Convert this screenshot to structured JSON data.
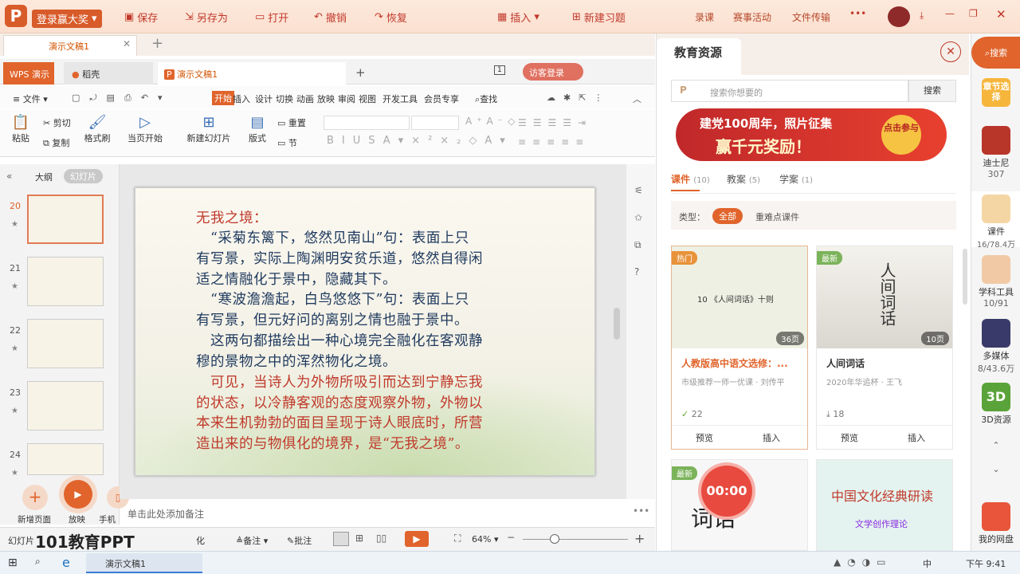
{
  "topbar": {
    "login": "登录赢大奖",
    "save": "保存",
    "save_as": "另存为",
    "open": "打开",
    "undo": "撤销",
    "redo": "恢复",
    "insert": "插入",
    "new_quiz": "新建习题",
    "record": "录课",
    "events": "赛事活动",
    "file_transfer": "文件传输"
  },
  "doc_tab": {
    "title": "演示文稿1"
  },
  "win_tabs": {
    "wps": "WPS 演示",
    "daoke": "稻壳",
    "doc": "演示文稿1",
    "guest_login": "访客登录"
  },
  "menu": {
    "file": "文件",
    "items": [
      "开始",
      "插入",
      "设计",
      "切换",
      "动画",
      "放映",
      "审阅",
      "视图",
      "开发工具",
      "会员专享"
    ],
    "search": "查找"
  },
  "ribbon": {
    "paste": "粘贴",
    "cut": "剪切",
    "copy": "复制",
    "format_painter": "格式刷",
    "from_current": "当页开始",
    "new_slide": "新建幻灯片",
    "layout": "版式",
    "reset": "重置",
    "section": "节"
  },
  "left_panel": {
    "outline": "大纲",
    "slides": "幻灯片",
    "numbers": [
      "20",
      "21",
      "22",
      "23",
      "24"
    ],
    "new_page": "新增页面",
    "play": "放映",
    "phone_remote": "手机遥控"
  },
  "slide": {
    "lines": [
      {
        "text": "无我之境：",
        "color": "#c0392b"
      },
      {
        "text": "“采菊东篱下，悠然见南山”句：表面上只",
        "color": "#1f3a5f"
      },
      {
        "text": "有写景，实际上陶渊明安贫乐道，悠然自得闲",
        "color": "#1f3a5f"
      },
      {
        "text": "适之情融化于景中，隐藏其下。",
        "color": "#1f3a5f"
      },
      {
        "text": "“寒波澹澹起，白鸟悠悠下”句：表面上只",
        "color": "#1f3a5f"
      },
      {
        "text": "有写景，但元好问的离别之情也融于景中。",
        "color": "#1f3a5f"
      },
      {
        "text": "这两句都描绘出一种心境完全融化在客观静",
        "color": "#1f3a5f"
      },
      {
        "text": "穆的景物之中的浑然物化之境。",
        "color": "#1f3a5f"
      },
      {
        "text": "可见，当诗人为外物所吸引而达到宁静忘我",
        "color": "#c0392b"
      },
      {
        "text": "的状态，以冷静客观的态度观察外物，外物以",
        "color": "#c0392b"
      },
      {
        "text": "本来生机勃勃的面目呈现于诗人眼底时，所营",
        "color": "#c0392b"
      },
      {
        "text": "造出来的与物俱化的境界，是“无我之境”。",
        "color": "#c0392b"
      }
    ]
  },
  "notes_placeholder": "单击此处添加备注",
  "status": {
    "slide_label": "幻灯片",
    "notes": "备注",
    "comments": "批注",
    "zoom": "64%",
    "watermark": "101教育PPT",
    "partial": "化"
  },
  "edu": {
    "title": "教育资源",
    "search_placeholder": "搜索你想要的",
    "search_btn": "搜索",
    "banner_line1": "建党100周年，照片征集",
    "banner_line2": "赢千元奖励！",
    "banner_badge": "点击参与",
    "tabs": [
      {
        "label": "课件",
        "count": "(10)"
      },
      {
        "label": "教案",
        "count": "(5)"
      },
      {
        "label": "学案",
        "count": "(1)"
      }
    ],
    "type_label": "类型：",
    "filters": [
      "全部",
      "重难点课件"
    ],
    "cards": [
      {
        "badge": "热门",
        "inner": "10 《人间词话》十则",
        "pages": "36页",
        "title": "人教版高中语文选修：...",
        "sub": "市级推荐一师一优课 · 刘传平",
        "count": "22",
        "preview": "预览",
        "insert": "插入"
      },
      {
        "badge": "最新",
        "inner": "人间词话",
        "pages": "10页",
        "title": "人间词话",
        "sub": "2020年华追杯 · 王飞",
        "count": "18",
        "preview": "预览",
        "insert": "插入"
      }
    ],
    "card3_badge": "最新",
    "card3_inner": "词话",
    "card4_title": "中国文化经典研读",
    "card4_sub": "文学创作理论",
    "timer": "00:00"
  },
  "sidebar": {
    "search": "搜索",
    "chapter": "章节选择",
    "disney": "迪士尼",
    "disney_count": "307",
    "courseware": "课件",
    "courseware_count": "16/78.4万",
    "tools": "学科工具",
    "tools_count": "10/91",
    "media": "多媒体",
    "media_count": "8/43.6万",
    "res3d": "3D资源",
    "cloud": "我的网盘"
  },
  "taskbar": {
    "app": "演示文稿1",
    "time": "下午 9:41",
    "lang": "中"
  },
  "colors": {
    "accent": "#e0642b",
    "brand_red": "#c0392b",
    "slide_red": "#c0392b",
    "slide_blue": "#1f3a5f"
  }
}
